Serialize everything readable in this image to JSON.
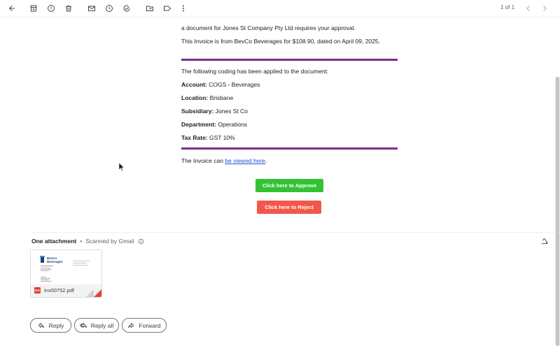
{
  "toolbar": {
    "icons": [
      "back-arrow-icon",
      "archive-icon",
      "report-spam-icon",
      "delete-icon",
      "mark-unread-icon",
      "snooze-icon",
      "add-to-tasks-icon",
      "move-to-icon",
      "label-icon",
      "more-vert-icon"
    ],
    "pager_text": "1 of 1"
  },
  "email": {
    "intro": "a document for Jones St Company Pty Ltd requires your approval.",
    "invoice_line": "This Invoice is from BevCo Beverages for $108.90, dated on April 09, 2025.",
    "coding_intro": "The following coding has been applied to the document:",
    "fields": [
      {
        "label": "Account:",
        "value": "COGS - Beverages"
      },
      {
        "label": "Location:",
        "value": "Brisbane"
      },
      {
        "label": "Subsidiary:",
        "value": "Jones St Co"
      },
      {
        "label": "Department:",
        "value": "Operations"
      },
      {
        "label": "Tax Rate:",
        "value": "GST 10%"
      }
    ],
    "view_prefix": "The Invoice can ",
    "view_link": "be viewed here",
    "view_suffix": ".",
    "approve_label": "Click here to Approve",
    "reject_label": "Click here to Reject",
    "rule_color": "#7b2d8b",
    "approve_color": "#33c233",
    "reject_color": "#f1584b"
  },
  "attachments": {
    "title": "One attachment",
    "separator": "•",
    "scanned": "Scanned by Gmail",
    "file": {
      "name": "inv00752.pdf",
      "badge": "PDF",
      "preview_brand": "BevCo Beverages"
    }
  },
  "actions": {
    "reply": "Reply",
    "reply_all": "Reply all",
    "forward": "Forward"
  }
}
